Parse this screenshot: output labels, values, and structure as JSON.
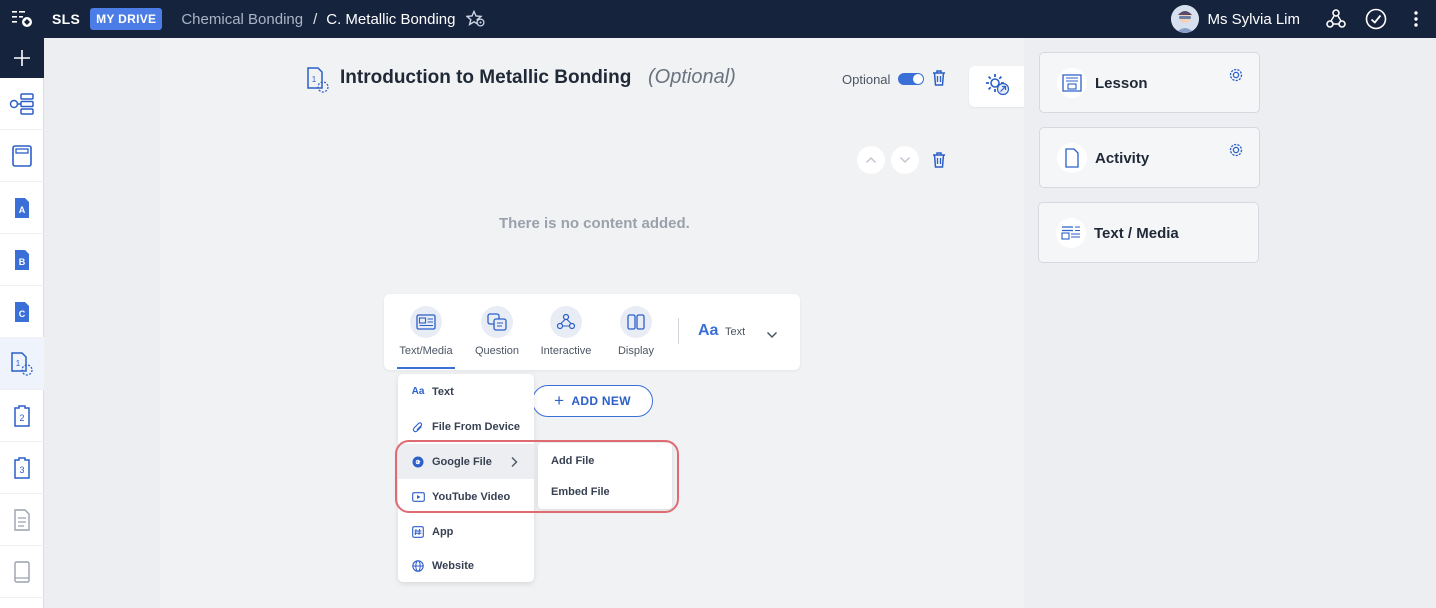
{
  "topbar": {
    "logo": "SLS",
    "drive_badge": "MY DRIVE",
    "breadcrumb_parent": "Chemical Bonding",
    "breadcrumb_sep": "/",
    "breadcrumb_current": "C. Metallic Bonding",
    "username": "Ms Sylvia Lim"
  },
  "rail": {
    "items": [
      {
        "icon": "add-icon"
      },
      {
        "icon": "lesson-map-icon"
      },
      {
        "icon": "notebook-icon"
      },
      {
        "icon": "section-a-icon",
        "letter": "A"
      },
      {
        "icon": "section-b-icon",
        "letter": "B"
      },
      {
        "icon": "section-c-icon",
        "letter": "C"
      },
      {
        "icon": "page-1-icon",
        "letter": "1"
      },
      {
        "icon": "page-2-icon",
        "letter": "2"
      },
      {
        "icon": "page-3-icon",
        "letter": "3"
      },
      {
        "icon": "document-icon"
      },
      {
        "icon": "book-icon"
      }
    ]
  },
  "page": {
    "title": "Introduction to Metallic Bonding",
    "optional_tag": "(Optional)",
    "optional_label": "Optional",
    "optional_enabled": true,
    "empty_message": "There is no content added."
  },
  "toolbar": {
    "tools": [
      {
        "label": "Text/Media"
      },
      {
        "label": "Question"
      },
      {
        "label": "Interactive"
      },
      {
        "label": "Display"
      }
    ],
    "text_style_glyph": "Aa",
    "text_style_label": "Text"
  },
  "add_new": {
    "label": "ADD NEW",
    "plus": "+"
  },
  "menu": {
    "items": [
      {
        "label": "Text",
        "icon_text": "Aa"
      },
      {
        "label": "File From Device"
      },
      {
        "label": "Google File"
      },
      {
        "label": "YouTube Video"
      },
      {
        "label": "App"
      },
      {
        "label": "Website"
      }
    ],
    "submenu": [
      {
        "label": "Add File"
      },
      {
        "label": "Embed File"
      }
    ]
  },
  "right_panel": {
    "cards": [
      {
        "label": "Lesson"
      },
      {
        "label": "Activity"
      },
      {
        "label": "Text / Media"
      }
    ]
  },
  "colors": {
    "topbar": "#16233d",
    "accent": "#3a6fd8",
    "highlight": "#df6b72"
  }
}
